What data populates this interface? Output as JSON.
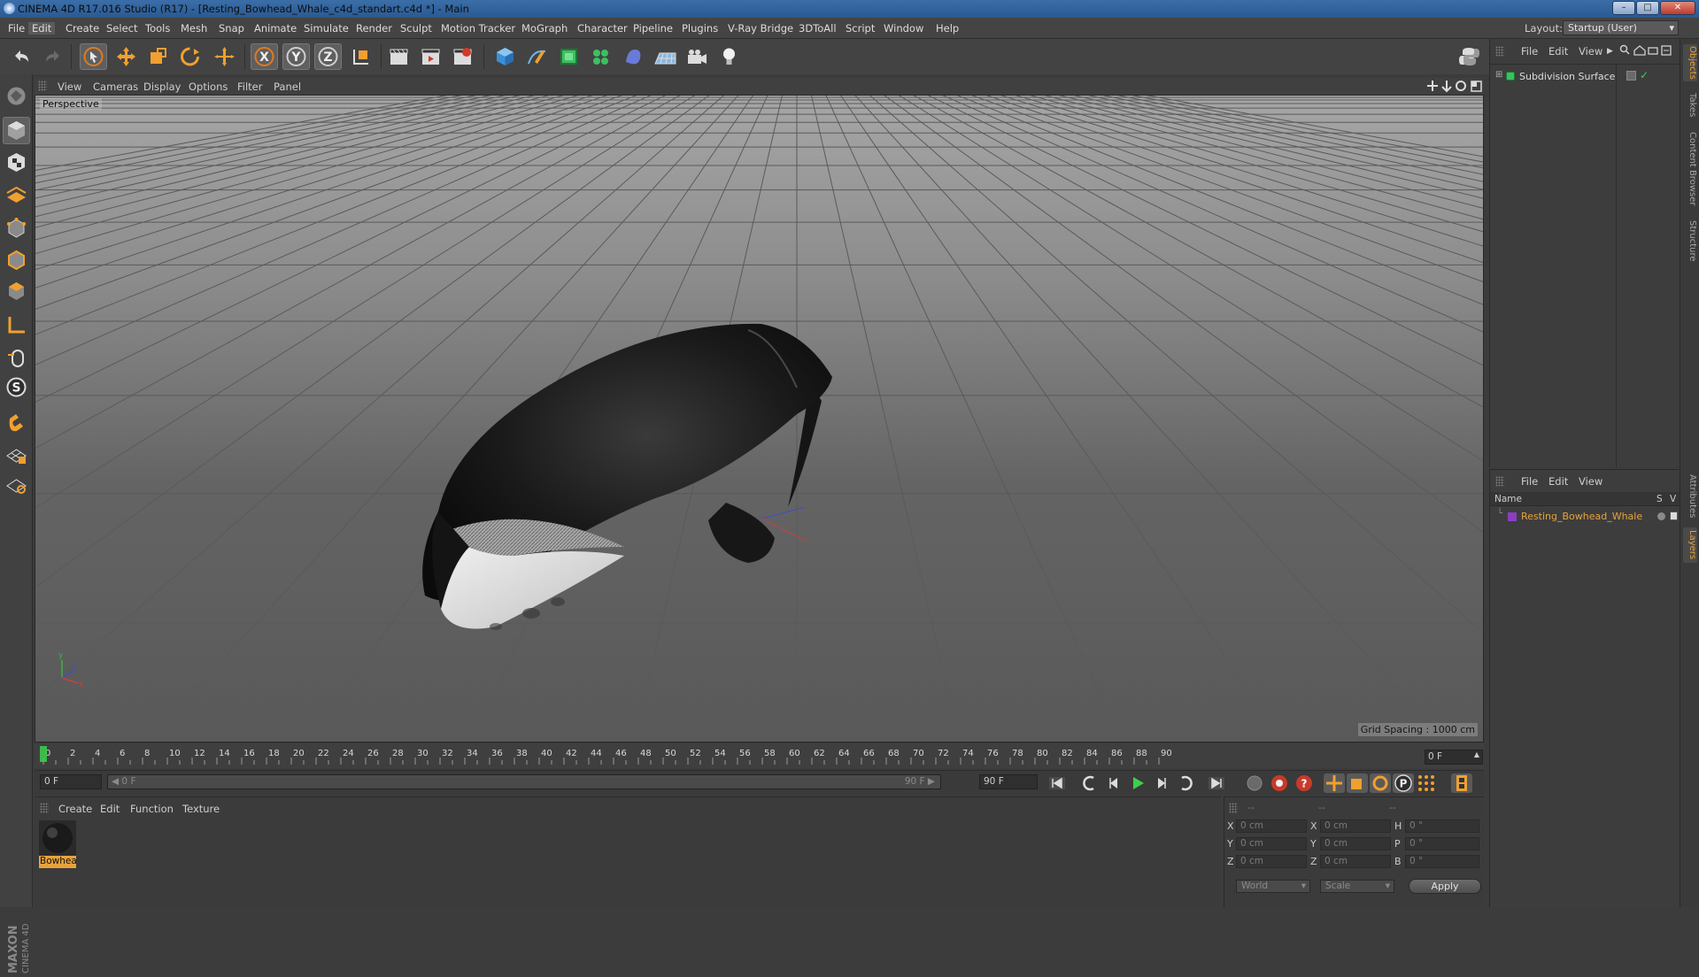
{
  "window": {
    "title": "CINEMA 4D R17.016 Studio (R17) - [Resting_Bowhead_Whale_c4d_standart.c4d *] - Main",
    "buttons": [
      "minimize",
      "maximize",
      "close"
    ]
  },
  "menubar": {
    "items": [
      "File",
      "Edit",
      "Create",
      "Select",
      "Tools",
      "Mesh",
      "Snap",
      "Animate",
      "Simulate",
      "Render",
      "Sculpt",
      "Motion Tracker",
      "MoGraph",
      "Character",
      "Pipeline",
      "Plugins",
      "V-Ray Bridge",
      "3DToAll",
      "Script",
      "Window",
      "Help"
    ],
    "active": "Edit",
    "layout_label": "Layout:",
    "layout_value": "Startup (User)"
  },
  "viewport": {
    "menu": [
      "View",
      "Cameras",
      "Display",
      "Options",
      "Filter",
      "Panel"
    ],
    "camera_label": "Perspective",
    "grid_spacing": "Grid Spacing : 1000 cm"
  },
  "timeline": {
    "ticks": [
      "0",
      "2",
      "4",
      "6",
      "8",
      "10",
      "12",
      "14",
      "16",
      "18",
      "20",
      "22",
      "24",
      "26",
      "28",
      "30",
      "32",
      "34",
      "36",
      "38",
      "40",
      "42",
      "44",
      "46",
      "48",
      "50",
      "52",
      "54",
      "56",
      "58",
      "60",
      "62",
      "64",
      "66",
      "68",
      "70",
      "72",
      "74",
      "76",
      "78",
      "80",
      "82",
      "84",
      "86",
      "88",
      "90"
    ],
    "current_frame": "0 F",
    "start_field": "0 F",
    "range_start": "0 F",
    "range_end": "90 F",
    "end_field": "90 F"
  },
  "material_panel": {
    "menu": [
      "Create",
      "Edit",
      "Function",
      "Texture"
    ],
    "materials": [
      {
        "name": "Bowhea"
      }
    ]
  },
  "coordinates": {
    "headers": [
      "--",
      "--",
      "--"
    ],
    "rows": [
      {
        "axis": "X",
        "pos": "0 cm",
        "axis2": "X",
        "size": "0 cm",
        "rot_axis": "H",
        "rot": "0 °"
      },
      {
        "axis": "Y",
        "pos": "0 cm",
        "axis2": "Y",
        "size": "0 cm",
        "rot_axis": "P",
        "rot": "0 °"
      },
      {
        "axis": "Z",
        "pos": "0 cm",
        "axis2": "Z",
        "size": "0 cm",
        "rot_axis": "B",
        "rot": "0 °"
      }
    ],
    "mode_select": "World",
    "type_select": "Scale",
    "apply_label": "Apply"
  },
  "object_manager": {
    "menu": [
      "File",
      "Edit",
      "View"
    ],
    "objects": [
      {
        "name": "Subdivision Surface"
      }
    ]
  },
  "layer_manager": {
    "menu": [
      "File",
      "Edit",
      "View"
    ],
    "columns": [
      "Name",
      "S",
      "V"
    ],
    "layers": [
      {
        "name": "Resting_Bowhead_Whale",
        "color": "#8a3fc0"
      }
    ]
  },
  "right_tabs": [
    "Objects",
    "Takes",
    "Content Browser",
    "Structure",
    "Attributes",
    "Layers"
  ],
  "branding": {
    "logo_text": "MAXON CINEMA 4D"
  },
  "colors": {
    "accent": "#e8a23a",
    "selection": "#2d6ad2",
    "axis_x": "#d03030",
    "axis_y": "#30b030",
    "axis_z": "#3050d0"
  }
}
